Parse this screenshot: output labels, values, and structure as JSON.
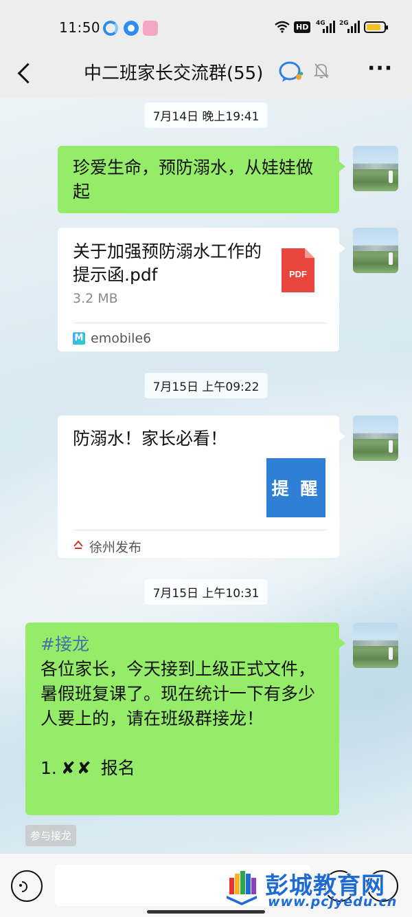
{
  "status_bar": {
    "time": "11:50",
    "network_1": "4G",
    "network_2": "2G",
    "hd_label": "HD",
    "battery_level": 0.85
  },
  "header": {
    "title": "中二班家长交流群(55)",
    "more_label": "···"
  },
  "messages": [
    {
      "timestamp": "7月14日 晚上19:41"
    },
    {
      "text": "珍爱生命，预防溺水，从娃娃做起"
    },
    {
      "file_name": "关于加强预防溺水工作的提示函.pdf",
      "file_size": "3.2 MB",
      "file_icon_label": "PDF",
      "source": "emobile6",
      "source_icon": "M"
    },
    {
      "timestamp": "7月15日 上午09:22"
    },
    {
      "title": "防溺水！家长必看！",
      "thumb_text": "提 醒",
      "source": "徐州发布"
    },
    {
      "timestamp": "7月15日 上午10:31"
    },
    {
      "tag": "#接龙",
      "body": "各位家长，今天接到上级正式文件，暑假班复课了。现在统计一下有多少人要上的，请在班级群接龙！",
      "item_number": "1.",
      "item_name": "✘✘",
      "item_action": "报名"
    }
  ],
  "join_button": "参与接龙",
  "watermark": {
    "title": "彭城教育网",
    "url": "www.pcjyedu.cn"
  },
  "colors": {
    "bubble_green": "#95ec69",
    "header_bg": "#ededed",
    "pdf_red": "#e8453c",
    "thumb_blue": "#2f7fd6"
  },
  "icons": [
    "back-arrow-icon",
    "group-chat-icon",
    "mute-bell-icon",
    "more-icon",
    "pdf-icon",
    "voice-icon",
    "emoji-icon",
    "plus-icon"
  ]
}
